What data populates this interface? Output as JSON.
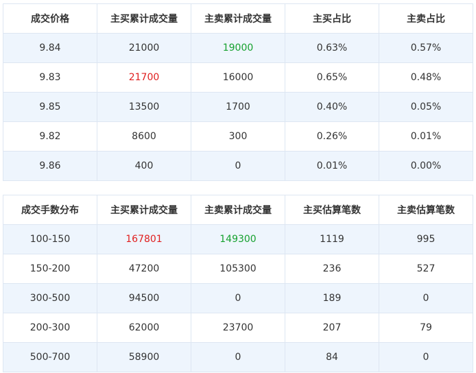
{
  "colors": {
    "red": "#e02020",
    "green": "#16a12f",
    "odd_row_bg": "#eef5fd",
    "border": "#dde6f2"
  },
  "price_table": {
    "headers": [
      "成交价格",
      "主买累计成交量",
      "主卖累计成交量",
      "主买占比",
      "主卖占比"
    ],
    "rows": [
      {
        "cells": [
          "9.84",
          "21000",
          "19000",
          "0.63%",
          "0.57%"
        ],
        "colors": [
          "",
          "",
          "green",
          "",
          ""
        ]
      },
      {
        "cells": [
          "9.83",
          "21700",
          "16000",
          "0.65%",
          "0.48%"
        ],
        "colors": [
          "",
          "red",
          "",
          "",
          ""
        ]
      },
      {
        "cells": [
          "9.85",
          "13500",
          "1700",
          "0.40%",
          "0.05%"
        ],
        "colors": [
          "",
          "",
          "",
          "",
          ""
        ]
      },
      {
        "cells": [
          "9.82",
          "8600",
          "300",
          "0.26%",
          "0.01%"
        ],
        "colors": [
          "",
          "",
          "",
          "",
          ""
        ]
      },
      {
        "cells": [
          "9.86",
          "400",
          "0",
          "0.01%",
          "0.00%"
        ],
        "colors": [
          "",
          "",
          "",
          "",
          ""
        ]
      }
    ]
  },
  "volume_table": {
    "headers": [
      "成交手数分布",
      "主买累计成交量",
      "主卖累计成交量",
      "主买估算笔数",
      "主卖估算笔数"
    ],
    "rows": [
      {
        "cells": [
          "100-150",
          "167801",
          "149300",
          "1119",
          "995"
        ],
        "colors": [
          "",
          "red",
          "green",
          "",
          ""
        ]
      },
      {
        "cells": [
          "150-200",
          "47200",
          "105300",
          "236",
          "527"
        ],
        "colors": [
          "",
          "",
          "",
          "",
          ""
        ]
      },
      {
        "cells": [
          "300-500",
          "94500",
          "0",
          "189",
          "0"
        ],
        "colors": [
          "",
          "",
          "",
          "",
          ""
        ]
      },
      {
        "cells": [
          "200-300",
          "62000",
          "23700",
          "207",
          "79"
        ],
        "colors": [
          "",
          "",
          "",
          "",
          ""
        ]
      },
      {
        "cells": [
          "500-700",
          "58900",
          "0",
          "84",
          "0"
        ],
        "colors": [
          "",
          "",
          "",
          "",
          ""
        ]
      }
    ]
  }
}
